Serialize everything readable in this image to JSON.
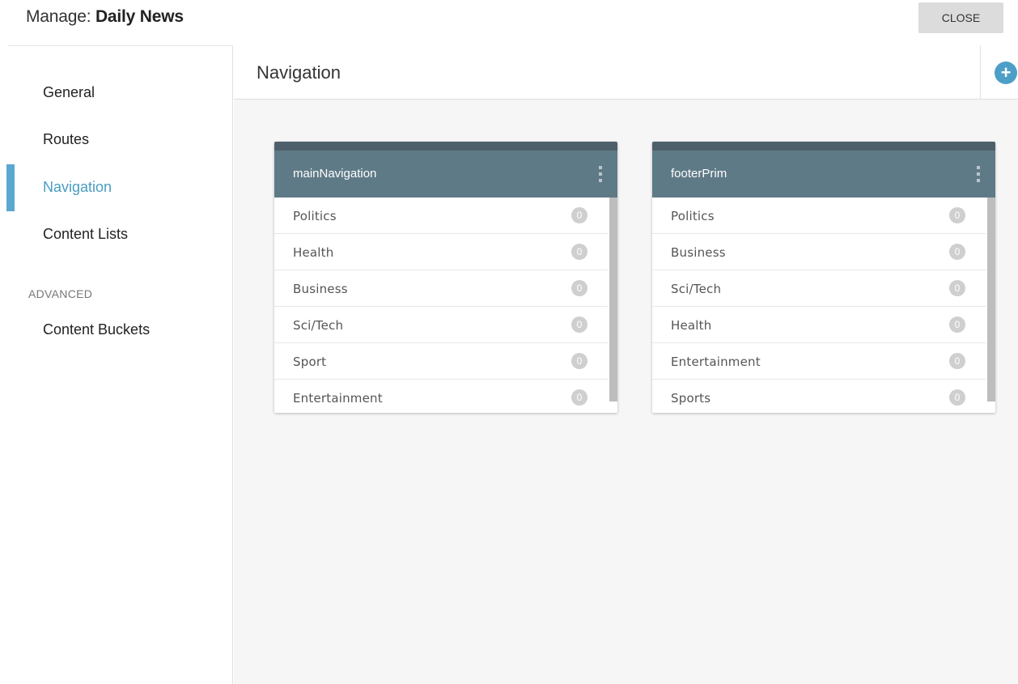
{
  "header": {
    "title_label": "Manage:",
    "title_name": "Daily News",
    "close_label": "CLOSE"
  },
  "sidebar": {
    "items": [
      {
        "label": "General"
      },
      {
        "label": "Routes"
      },
      {
        "label": "Navigation"
      },
      {
        "label": "Content Lists"
      }
    ],
    "section_label": "ADVANCED",
    "advanced_items": [
      {
        "label": "Content Buckets"
      }
    ]
  },
  "main": {
    "title": "Navigation",
    "add_icon": "plus-icon",
    "cards": [
      {
        "title": "mainNavigation",
        "items": [
          {
            "label": "Politics",
            "count": "0"
          },
          {
            "label": "Health",
            "count": "0"
          },
          {
            "label": "Business",
            "count": "0"
          },
          {
            "label": "Sci/Tech",
            "count": "0"
          },
          {
            "label": "Sport",
            "count": "0"
          },
          {
            "label": "Entertainment",
            "count": "0"
          }
        ]
      },
      {
        "title": "footerPrim",
        "items": [
          {
            "label": "Politics",
            "count": "0"
          },
          {
            "label": "Business",
            "count": "0"
          },
          {
            "label": "Sci/Tech",
            "count": "0"
          },
          {
            "label": "Health",
            "count": "0"
          },
          {
            "label": "Entertainment",
            "count": "0"
          },
          {
            "label": "Sports",
            "count": "0"
          }
        ]
      }
    ]
  },
  "colors": {
    "accent": "#4a9cc2",
    "card_header": "#5f7a87",
    "card_strip": "#4d5f6a"
  }
}
